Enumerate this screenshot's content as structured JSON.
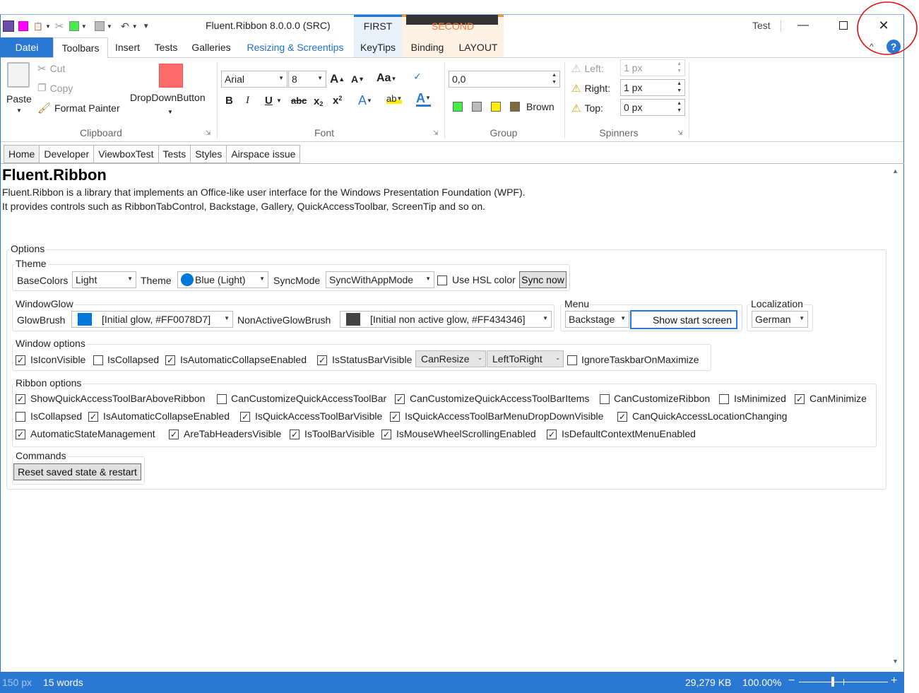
{
  "window": {
    "title": "Fluent.Ribbon 8.0.0.0 (SRC)",
    "test_label": "Test",
    "context_first": "FIRST",
    "context_second": "SECOND"
  },
  "colors": {
    "accent": "#2b78d4",
    "swatch_magenta": "#ff00ff",
    "swatch_green": "#44ee44",
    "swatch_gray": "#bbbbbb",
    "swatch_yellow": "#ffee00",
    "swatch_brown": "#806a3a",
    "dropdown_button": "#ff6b6b",
    "glow_blue": "#0078d7",
    "glow_dark": "#434346"
  },
  "tabs": {
    "file": "Datei",
    "items": [
      "Toolbars",
      "Insert",
      "Tests",
      "Galleries",
      "Resizing & Screentips",
      "KeyTips",
      "Binding",
      "LAYOUT"
    ]
  },
  "clipboard": {
    "paste": "Paste",
    "cut": "Cut",
    "copy": "Copy",
    "format_painter": "Format Painter",
    "dropdown_button": "DropDownButton",
    "label": "Clipboard"
  },
  "font": {
    "family": "Arial",
    "size": "8",
    "grow": "A",
    "shrink": "A",
    "case": "Aa",
    "bold": "B",
    "italic": "I",
    "underline": "U",
    "strike": "abc",
    "sub": "x",
    "sup": "x",
    "label": "Font"
  },
  "group": {
    "value": "0,0",
    "brown": "Brown",
    "label": "Group"
  },
  "spinners": {
    "left_label": "Left:",
    "left_value": "1 px",
    "right_label": "Right:",
    "right_value": "1 px",
    "top_label": "Top:",
    "top_value": "0 px",
    "label": "Spinners"
  },
  "pagetabs": [
    "Home",
    "Developer",
    "ViewboxTest",
    "Tests",
    "Styles",
    "Airspace issue"
  ],
  "content": {
    "heading": "Fluent.Ribbon",
    "line1": "Fluent.Ribbon is a library that implements an Office-like user interface for the Windows Presentation Foundation (WPF).",
    "line2": "It provides controls such as RibbonTabControl, Backstage, Gallery, QuickAccessToolbar, ScreenTip and so on."
  },
  "options": {
    "legend": "Options",
    "theme": {
      "legend": "Theme",
      "basecolors_label": "BaseColors",
      "basecolors_value": "Light",
      "theme_label": "Theme",
      "theme_value": "Blue (Light)",
      "syncmode_label": "SyncMode",
      "syncmode_value": "SyncWithAppMode",
      "hsl_label": "Use HSL color",
      "sync_now": "Sync now"
    },
    "windowglow": {
      "legend": "WindowGlow",
      "glowbrush_label": "GlowBrush",
      "glowbrush_value": "[Initial glow, #FF0078D7]",
      "nonactive_label": "NonActiveGlowBrush",
      "nonactive_value": "[Initial non active glow, #FF434346]"
    },
    "menu": {
      "legend": "Menu",
      "value": "Backstage",
      "show_start": "Show start screen"
    },
    "localization": {
      "legend": "Localization",
      "value": "German"
    },
    "window_options": {
      "legend": "Window options",
      "isiconvisible": "IsIconVisible",
      "iscollapsed": "IsCollapsed",
      "isautocollapse": "IsAutomaticCollapseEnabled",
      "isstatusbar": "IsStatusBarVisible",
      "resize_value": "CanResize",
      "flow_value": "LeftToRight",
      "ignore_taskbar": "IgnoreTaskbarOnMaximize"
    },
    "ribbon_options": {
      "legend": "Ribbon options",
      "r1": [
        "ShowQuickAccessToolBarAboveRibbon",
        "CanCustomizeQuickAccessToolBar",
        "CanCustomizeQuickAccessToolBarItems",
        "CanCustomizeRibbon",
        "IsMinimized",
        "CanMinimize"
      ],
      "r2": [
        "IsCollapsed",
        "IsAutomaticCollapseEnabled",
        "IsQuickAccessToolBarVisible",
        "IsQuickAccessToolBarMenuDropDownVisible",
        "CanQuickAccessLocationChanging"
      ],
      "r3": [
        "AutomaticStateManagement",
        "AreTabHeadersVisible",
        "IsToolBarVisible",
        "IsMouseWheelScrollingEnabled",
        "IsDefaultContextMenuEnabled"
      ]
    },
    "commands": {
      "legend": "Commands",
      "reset": "Reset saved state & restart"
    }
  },
  "statusbar": {
    "px": "150 px",
    "words": "15 words",
    "size": "29,279 KB",
    "zoom": "100.00%",
    "zoom_fraction": 0.5
  }
}
